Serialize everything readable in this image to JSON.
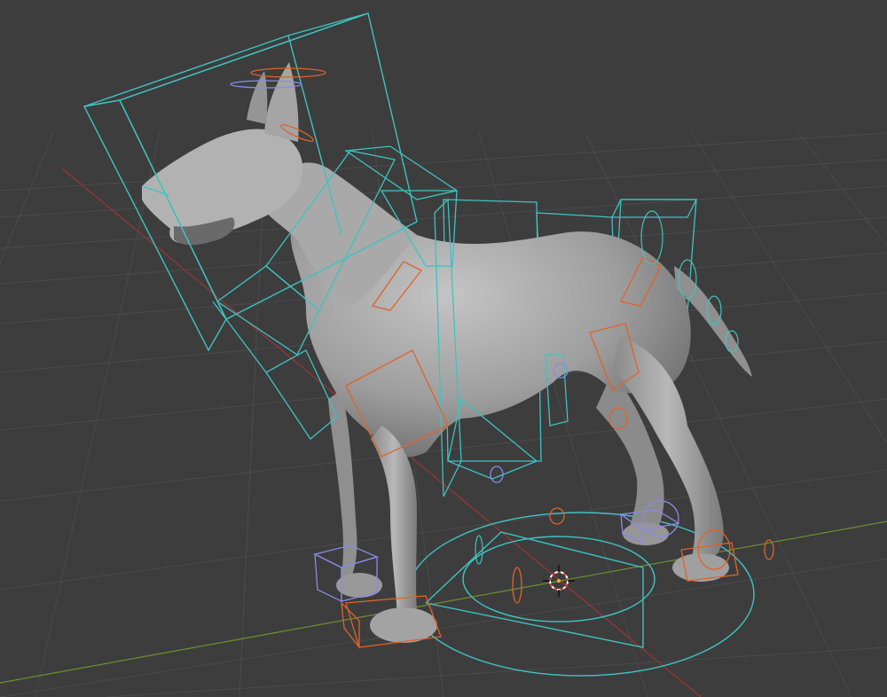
{
  "viewport": {
    "background_color": "#3d3d3d",
    "grid_color": "#4a4a4a",
    "x_axis_color": "#b23a3a",
    "y_axis_color": "#7fa33a",
    "control_color": "#3fc2c2",
    "deform_color": "#e0622c",
    "ik_color": "#8a8ae8",
    "mesh_color": "#a8a8a8"
  },
  "scene": {
    "object": "dog-mesh",
    "rig": "dog-armature",
    "cursor": "3d-cursor-icon"
  }
}
